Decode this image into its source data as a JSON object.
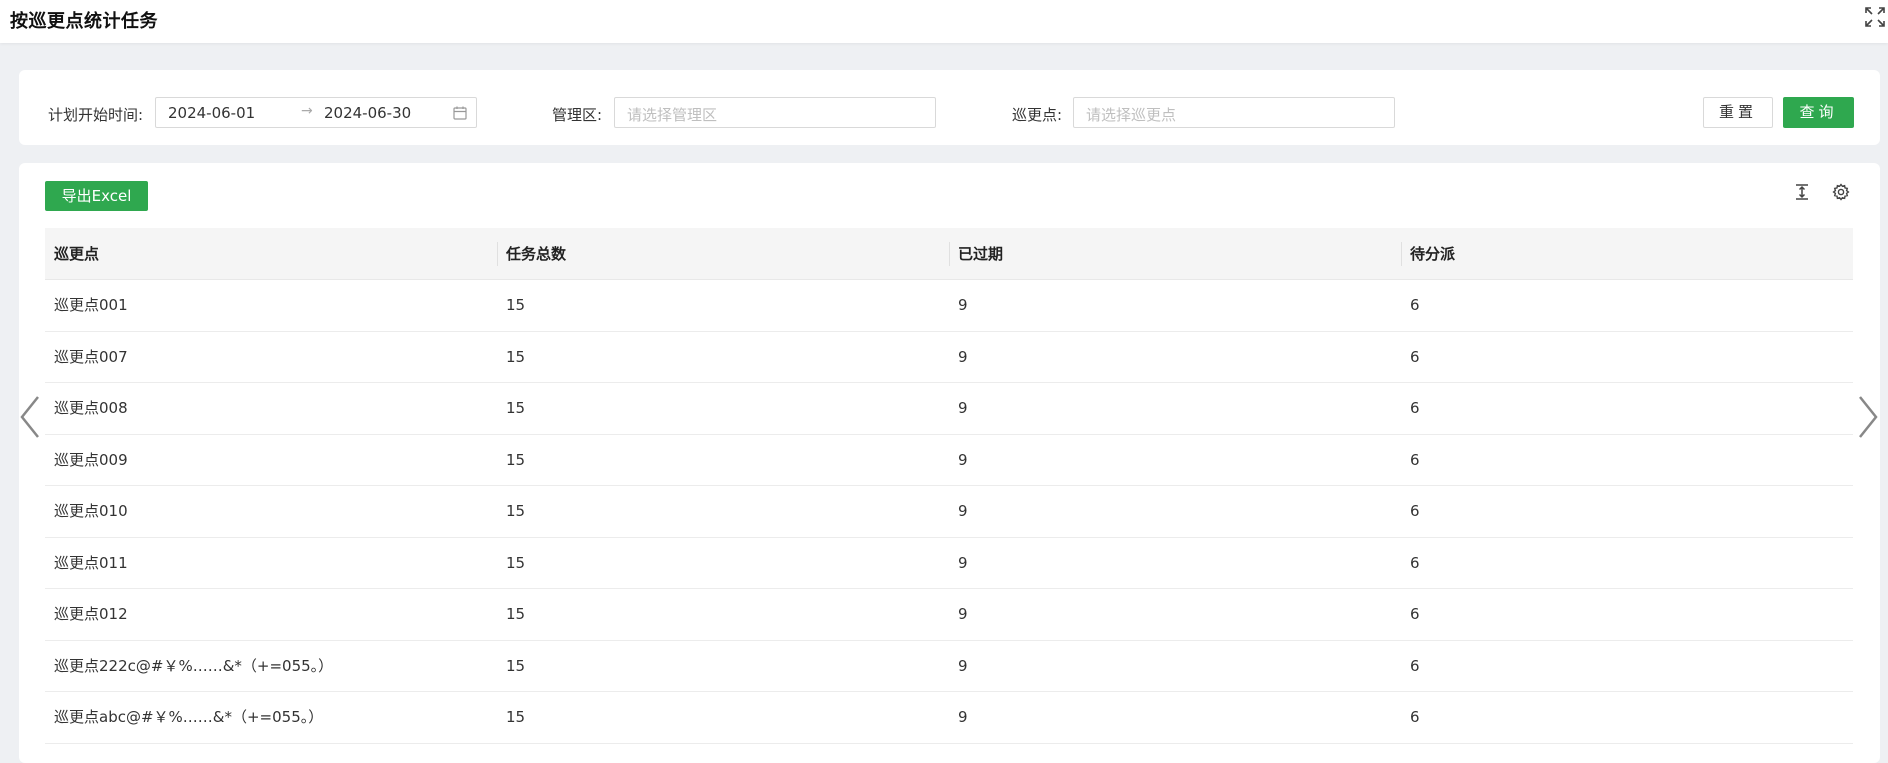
{
  "header": {
    "title": "按巡更点统计任务",
    "fullscreen_icon": "fullscreen-icon"
  },
  "filters": {
    "date_label": "计划开始时间:",
    "date_start": "2024-06-01",
    "date_end": "2024-06-30",
    "date_separator": "→",
    "area_label": "管理区:",
    "area_placeholder": "请选择管理区",
    "point_label": "巡更点:",
    "point_placeholder": "请选择巡更点",
    "reset_label": "重置",
    "query_label": "查询"
  },
  "toolbar": {
    "export_label": "导出Excel"
  },
  "table": {
    "columns": [
      "巡更点",
      "任务总数",
      "已过期",
      "待分派"
    ],
    "rows": [
      [
        "巡更点001",
        "15",
        "9",
        "6"
      ],
      [
        "巡更点007",
        "15",
        "9",
        "6"
      ],
      [
        "巡更点008",
        "15",
        "9",
        "6"
      ],
      [
        "巡更点009",
        "15",
        "9",
        "6"
      ],
      [
        "巡更点010",
        "15",
        "9",
        "6"
      ],
      [
        "巡更点011",
        "15",
        "9",
        "6"
      ],
      [
        "巡更点012",
        "15",
        "9",
        "6"
      ],
      [
        "巡更点222c@#￥%……&*（+=055。）",
        "15",
        "9",
        "6"
      ],
      [
        "巡更点abc@#￥%……&*（+=055。）",
        "15",
        "9",
        "6"
      ]
    ]
  },
  "colors": {
    "primary": "#2fa84f",
    "background": "#eef0f3",
    "header_bg": "#f5f5f5"
  }
}
